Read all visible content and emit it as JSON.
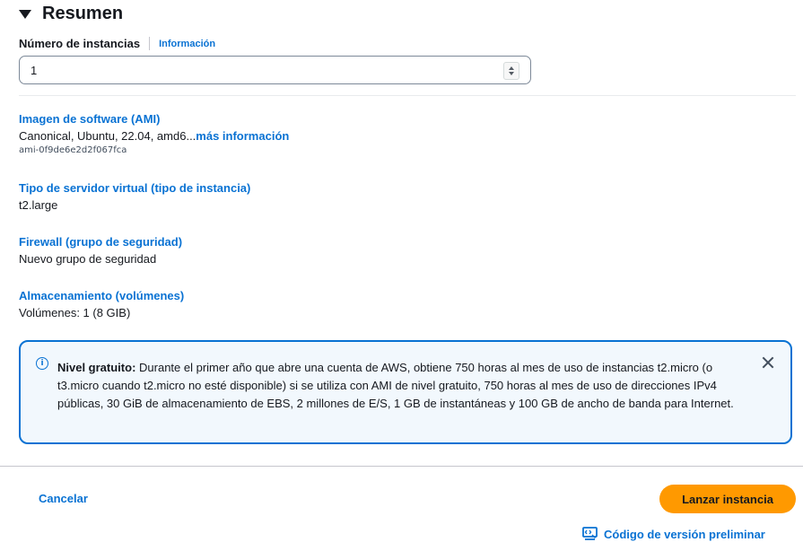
{
  "summary": {
    "title": "Resumen"
  },
  "instances": {
    "label": "Número de instancias",
    "info_link": "Información",
    "value": "1"
  },
  "sections": {
    "ami": {
      "title": "Imagen de software (AMI)",
      "value": "Canonical, Ubuntu, 22.04, amd6...",
      "more": "más información",
      "id": "ami-0f9de6e2d2f067fca"
    },
    "instance_type": {
      "title": "Tipo de servidor virtual (tipo de instancia)",
      "value": "t2.large"
    },
    "firewall": {
      "title": "Firewall (grupo de seguridad)",
      "value": "Nuevo grupo de seguridad"
    },
    "storage": {
      "title": "Almacenamiento (volúmenes)",
      "value": "Volúmenes: 1 (8 GIB)"
    }
  },
  "alert": {
    "heading": "Nivel gratuito:",
    "body": " Durante el primer año que abre una cuenta de AWS, obtiene 750 horas al mes de uso de instancias t2.micro (o t3.micro cuando t2.micro no esté disponible) si se utiliza con AMI de nivel gratuito, 750 horas al mes de uso de direcciones IPv4 públicas, 30 GiB de almacenamiento de EBS, 2 millones de E/S, 1 GB de instantáneas y 100 GB de ancho de banda para Internet.",
    "icon": "info-icon"
  },
  "footer": {
    "cancel_label": "Cancelar",
    "launch_label": "Lanzar instancia",
    "preview_label": "Código de versión preliminar",
    "preview_icon": "code-preview-icon"
  },
  "colors": {
    "link": "#0972d3",
    "primary_button": "#ff9900",
    "alert_border": "#0972d3",
    "alert_bg": "#f2f8fd"
  }
}
